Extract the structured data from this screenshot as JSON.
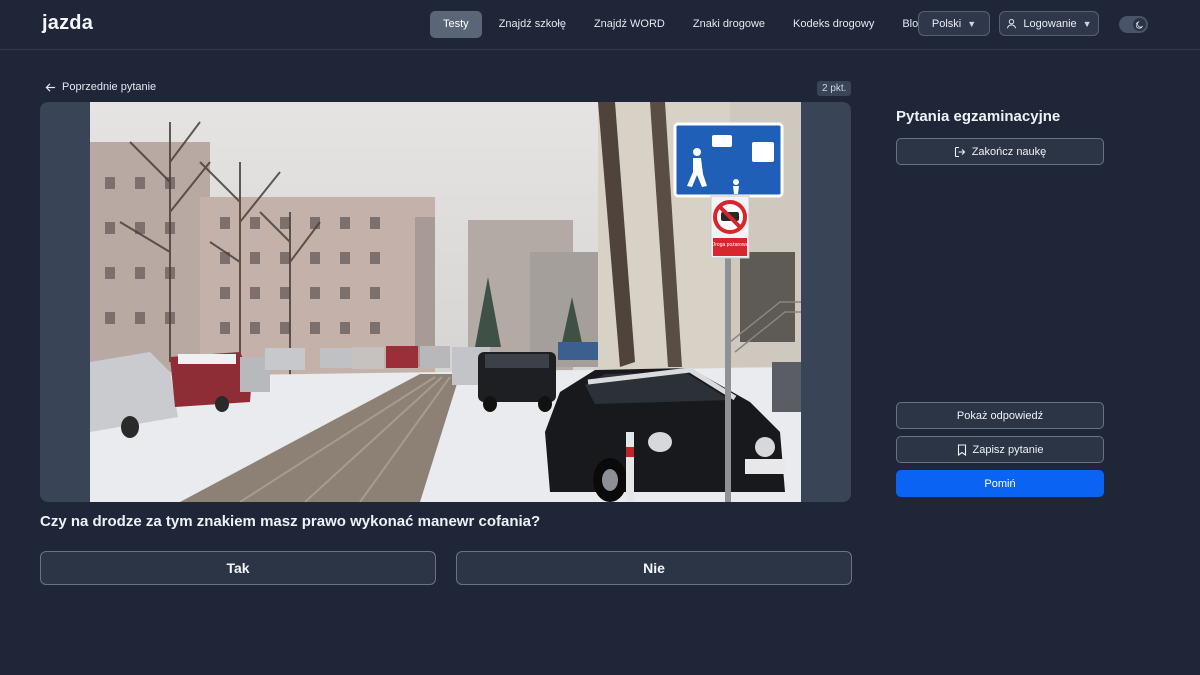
{
  "header": {
    "logo": "jazda",
    "nav": [
      {
        "label": "Testy",
        "active": true
      },
      {
        "label": "Znajdź szkołę",
        "active": false
      },
      {
        "label": "Znajdź WORD",
        "active": false
      },
      {
        "label": "Znaki drogowe",
        "active": false
      },
      {
        "label": "Kodeks drogowy",
        "active": false
      },
      {
        "label": "Blog",
        "active": false
      }
    ],
    "language": "Polski",
    "login": "Logowanie"
  },
  "question": {
    "back_label": "Poprzednie pytanie",
    "points": "2 pkt.",
    "text": "Czy na drodze za tym znakiem masz prawo wykonać manewr cofania?",
    "answers": [
      "Tak",
      "Nie"
    ],
    "sign_text": "Droga pożarowa"
  },
  "panel": {
    "title": "Pytania egzaminacyjne",
    "finish_label": "Zakończ naukę",
    "show_answer_label": "Pokaż odpowiedź",
    "save_label": "Zapisz pytanie",
    "skip_label": "Pomiń"
  },
  "colors": {
    "background": "#1e2638",
    "accent": "#0b63f3"
  },
  "icons": {
    "back": "arrow-left-icon",
    "login": "user-icon",
    "theme": "moon-icon",
    "finish": "logout-icon",
    "save": "bookmark-icon"
  }
}
